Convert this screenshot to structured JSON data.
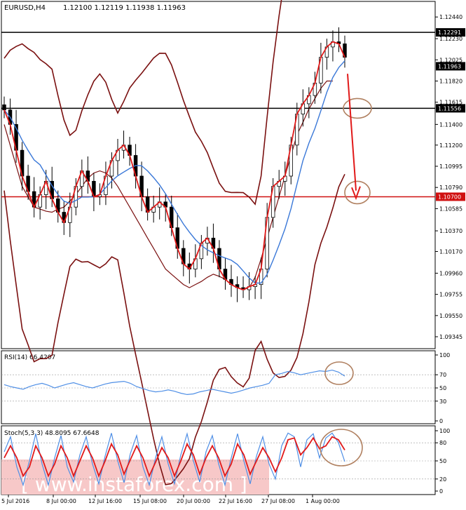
{
  "header": {
    "symbol": "EURUSD,H4",
    "ohlc": "1.12100 1.12119 1.11938 1.11963"
  },
  "colors": {
    "price_line": "#e11919",
    "candle": "#000000",
    "bollinger": "#7a1010",
    "ma_blue": "#3a78d8",
    "annotation": "#b08060",
    "rsi_line": "#4f8fe6",
    "stoch_main": "#4f8fe6",
    "stoch_signal": "#e11919",
    "watermark_bg": "#f7c8c8",
    "watermark_text": "#ffffff",
    "hline_black": "#000000",
    "hline_red": "#d01010"
  },
  "chart_data": [
    {
      "type": "line",
      "title": "EURUSD,H4",
      "subtitle": "1.12100 1.12119 1.11938 1.11963",
      "x": [
        "5 Jul 2016",
        "8 Jul 00:00",
        "12 Jul 16:00",
        "15 Jul 08:00",
        "20 Jul 00:00",
        "22 Jul 16:00",
        "27 Jul 08:00",
        "1 Aug 00:00"
      ],
      "ylim": [
        1.0925,
        1.1255
      ],
      "yticks": [
        "1.12440",
        "1.12230",
        "1.12025",
        "1.11820",
        "1.11615",
        "1.11400",
        "1.11200",
        "1.10995",
        "1.10790",
        "1.10585",
        "1.10370",
        "1.10170",
        "1.09960",
        "1.09755",
        "1.09550",
        "1.09345"
      ],
      "levels": [
        {
          "label": "1.12291",
          "value": 1.12291,
          "color": "#000000"
        },
        {
          "label": "1.11556",
          "value": 1.11556,
          "color": "#000000"
        },
        {
          "label": "1.10700",
          "value": 1.107,
          "color": "#d01010"
        }
      ],
      "current_price": {
        "label": "1.11963",
        "value": 1.11963
      },
      "series": [
        {
          "values": [
            1.1154,
            1.114,
            1.1115,
            1.109,
            1.1075,
            1.106,
            1.1072,
            1.1085,
            1.1068,
            1.1055,
            1.1045,
            1.106,
            1.108,
            1.1095,
            1.1085,
            1.107,
            1.1072,
            1.109,
            1.1105,
            1.1115,
            1.112,
            1.111,
            1.109,
            1.107,
            1.1055,
            1.106,
            1.1065,
            1.106,
            1.104,
            1.102,
            1.1005,
            1.1,
            1.101,
            1.1025,
            1.103,
            1.102,
            1.1,
            1.099,
            1.0985,
            1.0982,
            1.098,
            1.0983,
            1.0985,
            1.1,
            1.105,
            1.108,
            1.1085,
            1.109,
            1.112,
            1.115,
            1.116,
            1.1168,
            1.118,
            1.1205,
            1.1215,
            1.122,
            1.1218,
            1.1205
          ]
        },
        {
          "values": [
            1.114,
            1.112,
            1.11,
            1.108,
            1.107,
            1.106,
            1.1058,
            1.1056,
            1.1055,
            1.1058,
            1.106,
            1.1066,
            1.1072,
            1.108,
            1.1088,
            1.1093,
            1.1095,
            1.1093,
            1.1088,
            1.108,
            1.107,
            1.106,
            1.105,
            1.104,
            1.103,
            1.102,
            1.101,
            1.1,
            1.0995,
            1.099,
            1.0985,
            1.0982,
            1.0985,
            1.0988,
            1.0992,
            1.0995,
            1.0993,
            1.099,
            1.0985,
            1.0982,
            1.098,
            1.0982,
            1.0992,
            1.101,
            1.103,
            1.105,
            1.107,
            1.109,
            1.111,
            1.113,
            1.1142,
            1.1155,
            1.1165,
            1.1175,
            1.1182
          ]
        }
      ]
    },
    {
      "type": "line",
      "title": "RSI(14) 66.4207",
      "ylim": [
        0,
        100
      ],
      "yticks": [
        "100",
        "70",
        "50",
        "30",
        "0"
      ],
      "series": [
        {
          "values": [
            55,
            52,
            50,
            48,
            52,
            55,
            57,
            54,
            50,
            53,
            56,
            58,
            55,
            52,
            50,
            53,
            56,
            58,
            59,
            60,
            57,
            52,
            49,
            46,
            44,
            45,
            47,
            45,
            42,
            40,
            41,
            44,
            46,
            48,
            46,
            44,
            42,
            44,
            47,
            50,
            52,
            54,
            57,
            70,
            72,
            75,
            73,
            70,
            72,
            74,
            76,
            75,
            77,
            74,
            68
          ]
        }
      ]
    },
    {
      "type": "line",
      "title": "Stoch(5,3,3) 48.8095 67.6648",
      "ylim": [
        0,
        100
      ],
      "yticks": [
        "100",
        "80",
        "50",
        "20",
        "0"
      ],
      "series": [
        {
          "values": [
            65,
            90,
            40,
            10,
            50,
            95,
            45,
            10,
            55,
            92,
            40,
            15,
            60,
            90,
            45,
            12,
            58,
            96,
            50,
            14,
            62,
            92,
            40,
            10,
            55,
            90,
            45,
            12,
            60,
            95,
            50,
            15,
            65,
            92,
            45,
            10,
            55,
            95,
            50,
            12,
            58,
            90,
            45,
            20,
            75,
            96,
            90,
            40,
            85,
            95,
            55,
            88,
            96,
            80,
            49
          ]
        },
        {
          "values": [
            55,
            75,
            55,
            25,
            40,
            75,
            55,
            25,
            45,
            75,
            55,
            25,
            50,
            75,
            55,
            25,
            50,
            78,
            60,
            28,
            52,
            75,
            55,
            25,
            48,
            72,
            55,
            25,
            50,
            78,
            60,
            28,
            55,
            75,
            55,
            25,
            45,
            78,
            60,
            28,
            50,
            72,
            55,
            32,
            55,
            85,
            88,
            60,
            72,
            88,
            70,
            75,
            90,
            85,
            68
          ]
        }
      ]
    }
  ],
  "xaxis": {
    "labels": [
      "5 Jul 2016",
      "8 Jul 00:00",
      "12 Jul 16:00",
      "15 Jul 08:00",
      "20 Jul 00:00",
      "22 Jul 16:00",
      "27 Jul 08:00",
      "1 Aug 00:00"
    ]
  },
  "watermark": {
    "text": "[ www.instaforex.com ]"
  }
}
